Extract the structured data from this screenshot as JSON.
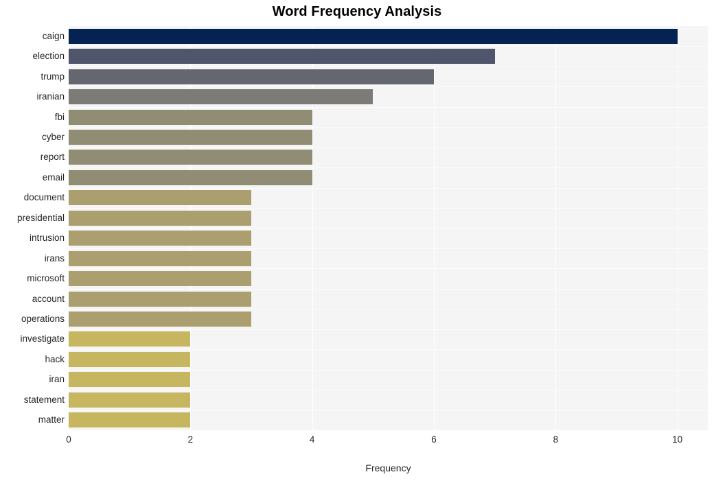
{
  "chart_data": {
    "type": "bar",
    "orientation": "horizontal",
    "title": "Word Frequency Analysis",
    "xlabel": "Frequency",
    "ylabel": "",
    "categories": [
      "caign",
      "election",
      "trump",
      "iranian",
      "fbi",
      "cyber",
      "report",
      "email",
      "document",
      "presidential",
      "intrusion",
      "irans",
      "microsoft",
      "account",
      "operations",
      "investigate",
      "hack",
      "iran",
      "statement",
      "matter"
    ],
    "values": [
      10,
      7,
      6,
      5,
      4,
      4,
      4,
      4,
      3,
      3,
      3,
      3,
      3,
      3,
      3,
      2,
      2,
      2,
      2,
      2
    ],
    "bar_colors": [
      "#042252",
      "#4f566b",
      "#64676f",
      "#7d7b76",
      "#918d75",
      "#918d75",
      "#918d75",
      "#918d75",
      "#ab9f6f",
      "#ab9f6f",
      "#ab9f6f",
      "#ab9f6f",
      "#ab9f6f",
      "#ab9f6f",
      "#ab9f6f",
      "#c6b65f",
      "#c6b65f",
      "#c6b65f",
      "#c6b65f",
      "#c6b65f"
    ],
    "xlim": [
      0,
      10.5
    ],
    "xticks": [
      0,
      2,
      4,
      6,
      8,
      10
    ],
    "xtick_labels": [
      "0",
      "2",
      "4",
      "6",
      "8",
      "10"
    ],
    "grid": true,
    "grid_axis": "x",
    "grid_color": "#ffffff",
    "plot_background": "#f5f5f5",
    "figure_background": "#ffffff",
    "legend": null,
    "legend_position": "none"
  }
}
